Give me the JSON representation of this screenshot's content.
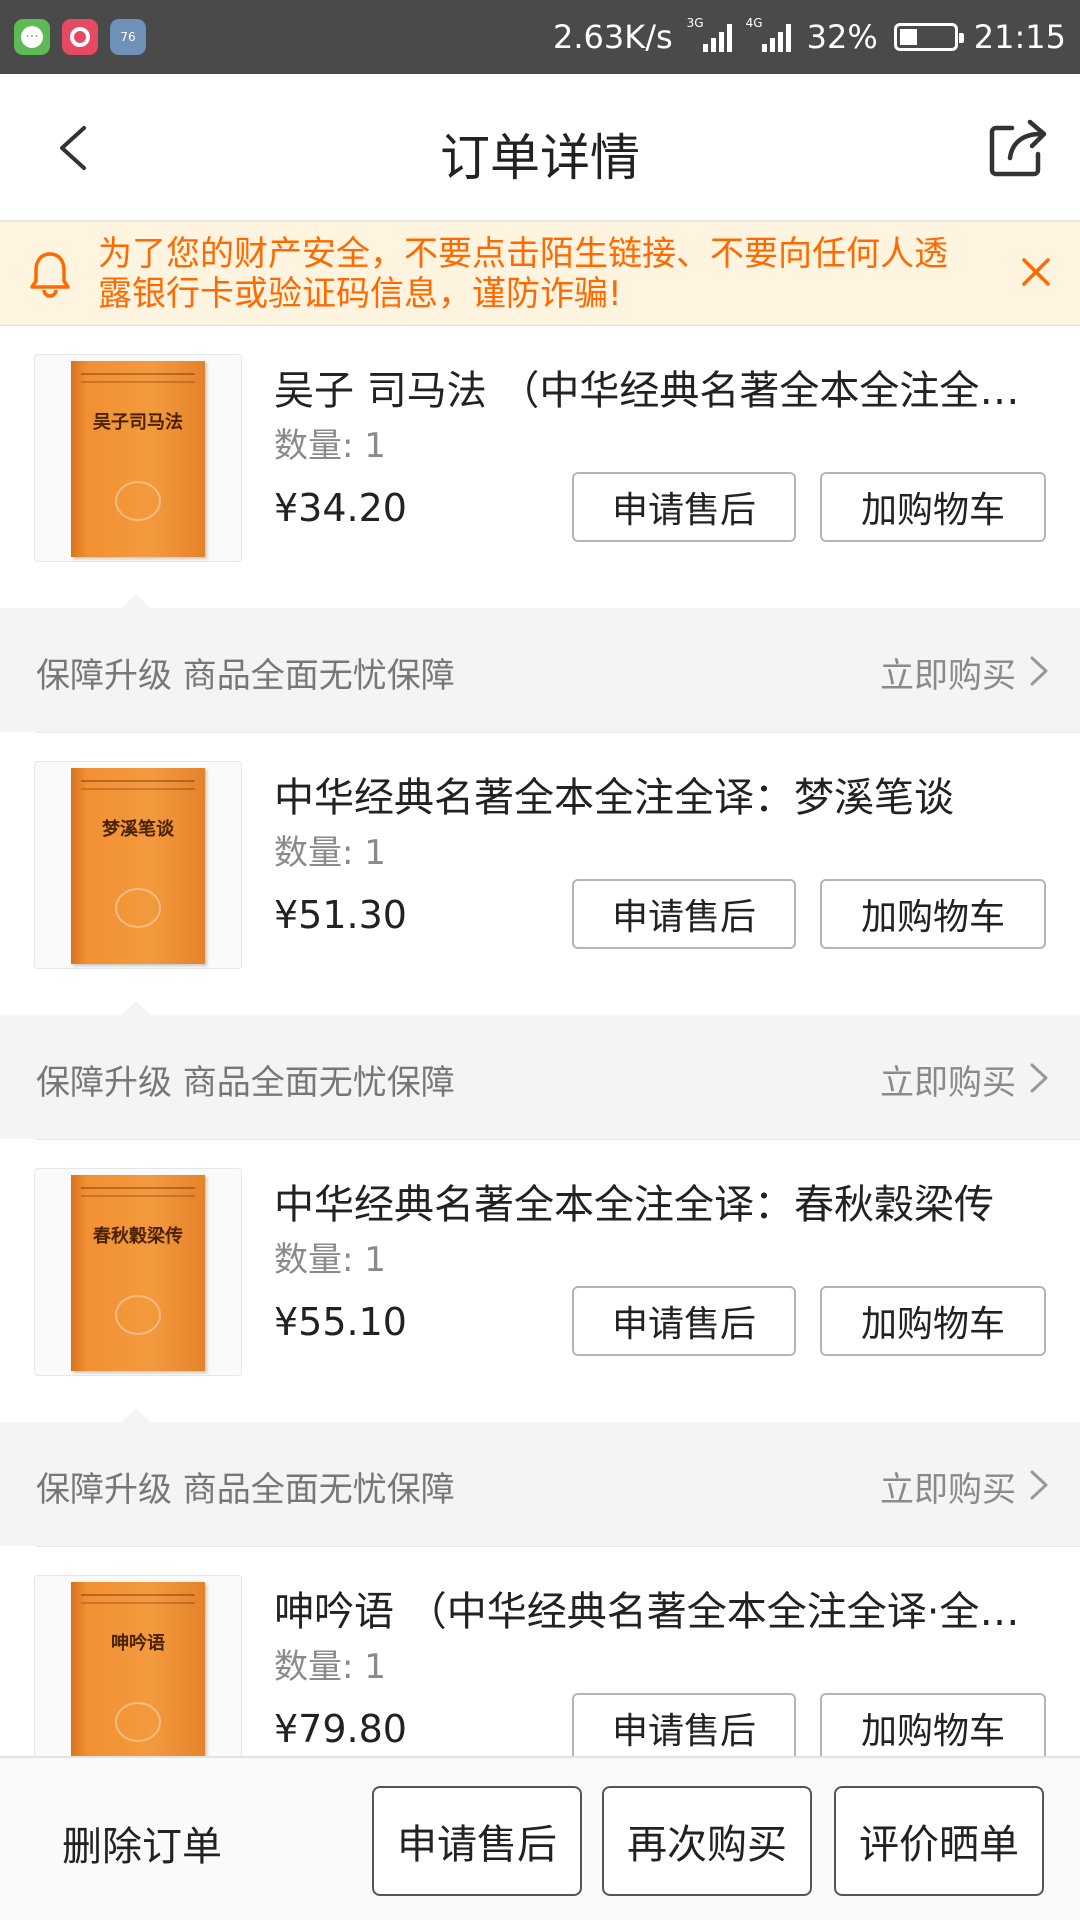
{
  "status_bar": {
    "net_speed": "2.63K/s",
    "signal1_label": "3G",
    "signal2_label": "4G",
    "battery_percent": "32%",
    "battery_level": 0.32,
    "time": "21:15",
    "blue_icon_text": "76"
  },
  "header": {
    "title": "订单详情"
  },
  "notice": {
    "text": "为了您的财产安全，不要点击陌生链接、不要向任何人透露银行卡或验证码信息，谨防诈骗!"
  },
  "items": [
    {
      "title": "吴子 司马法 （中华经典名著全本全注全译丛书）",
      "cover_text": "吴子司马法",
      "quantity": "数量: 1",
      "price": "¥34.20",
      "after_sale": "申请售后",
      "add_cart": "加购物车"
    },
    {
      "title": "中华经典名著全本全注全译：梦溪笔谈",
      "cover_text": "梦溪笔谈",
      "quantity": "数量: 1",
      "price": "¥51.30",
      "after_sale": "申请售后",
      "add_cart": "加购物车"
    },
    {
      "title": "中华经典名著全本全注全译：春秋穀梁传",
      "cover_text": "春秋穀梁传",
      "quantity": "数量: 1",
      "price": "¥55.10",
      "after_sale": "申请售后",
      "add_cart": "加购物车"
    },
    {
      "title": "呻吟语 （中华经典名著全本全注全译·全本全注全译丛书）",
      "cover_text": "呻吟语",
      "quantity": "数量: 1",
      "price": "¥79.80",
      "after_sale": "申请售后",
      "add_cart": "加购物车"
    }
  ],
  "guarantee": {
    "text": "保障升级 商品全面无忧保障",
    "buy_now": "立即购买"
  },
  "bottom_bar": {
    "delete_order": "删除订单",
    "apply_after_sale": "申请售后",
    "buy_again": "再次购买",
    "review": "评价晒单"
  },
  "colors": {
    "notice_text": "#ff6a00",
    "notice_bg": "#fff4e0",
    "status_bar_bg": "#4a4a4a",
    "book_orange": "#f29033"
  }
}
